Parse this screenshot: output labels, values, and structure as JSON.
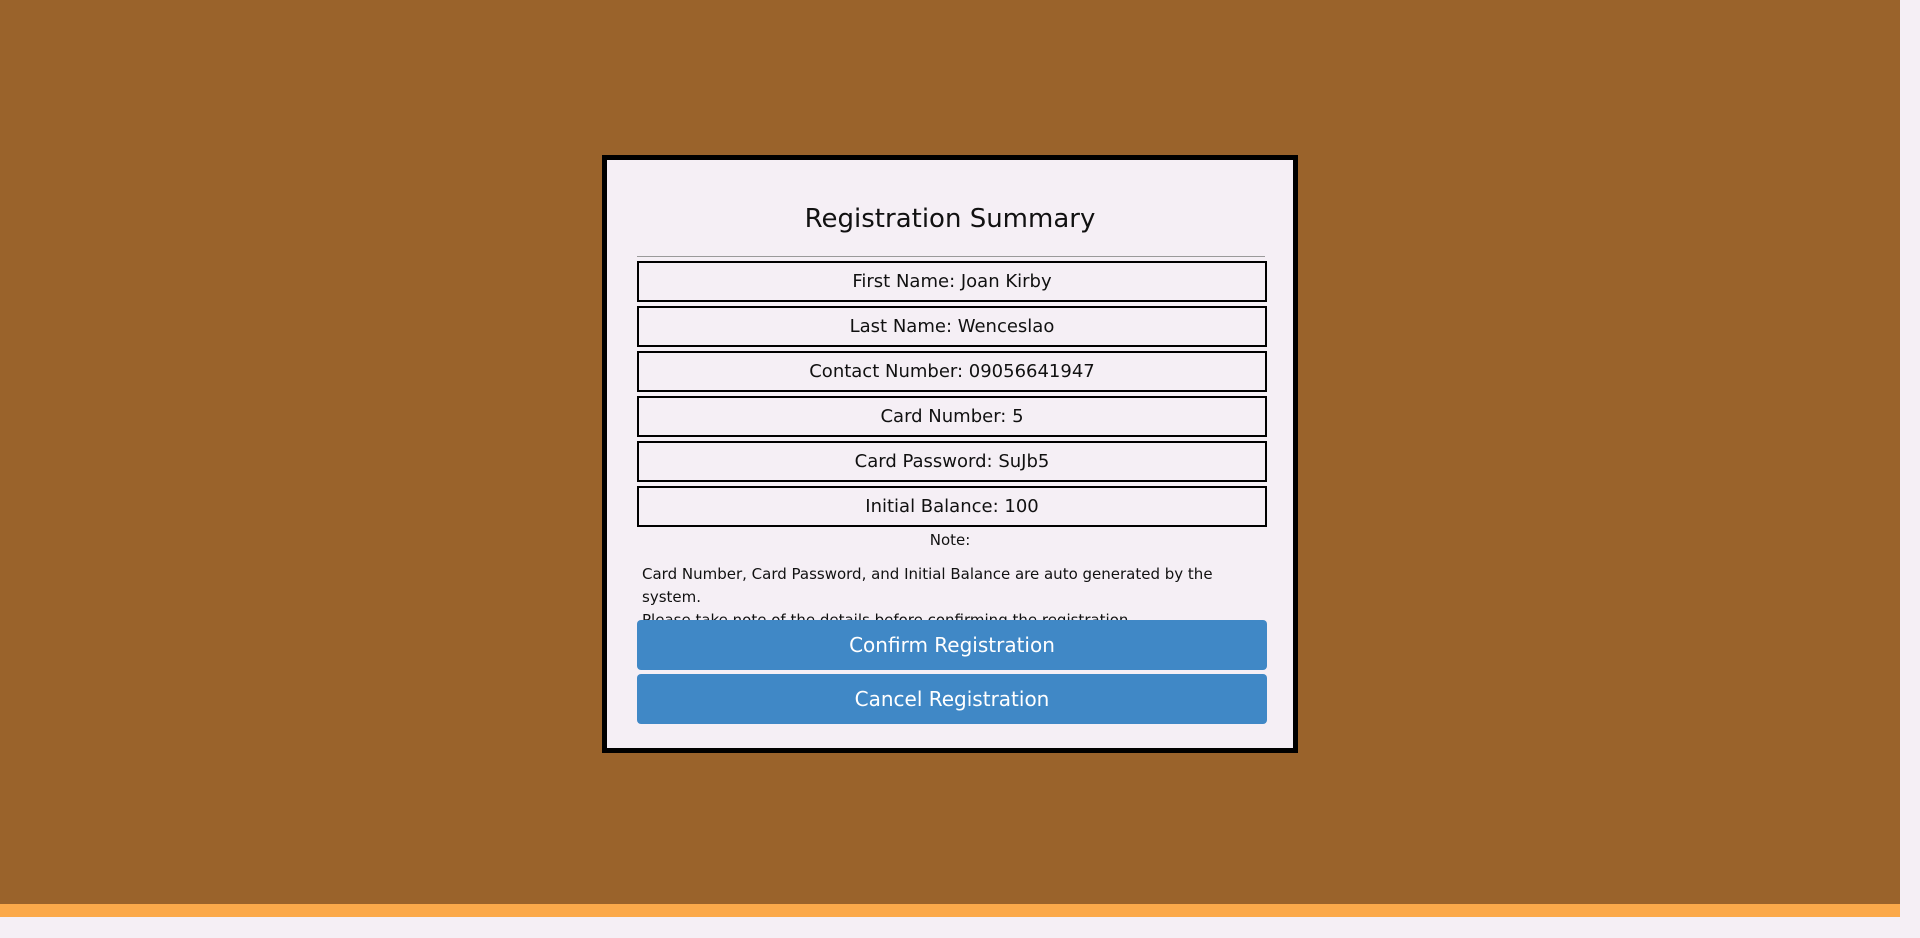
{
  "colors": {
    "page_background": "#9a632b",
    "bottom_strip": "#fba94a",
    "modal_background": "#f5eff5",
    "button_background": "#4088c6"
  },
  "modal": {
    "title": "Registration Summary",
    "fields": [
      {
        "text": "First Name: Joan Kirby"
      },
      {
        "text": "Last Name: Wenceslao"
      },
      {
        "text": "Contact Number: 09056641947"
      },
      {
        "text": "Card Number: 5"
      },
      {
        "text": "Card Password: SuJb5"
      },
      {
        "text": "Initial Balance: 100"
      }
    ],
    "note_label": "Note:",
    "note_line1": "Card Number, Card Password, and Initial Balance are auto generated by the system.",
    "note_line2": "Please take note of the details before confirming the registration.",
    "confirm_label": "Confirm Registration",
    "cancel_label": "Cancel Registration"
  }
}
